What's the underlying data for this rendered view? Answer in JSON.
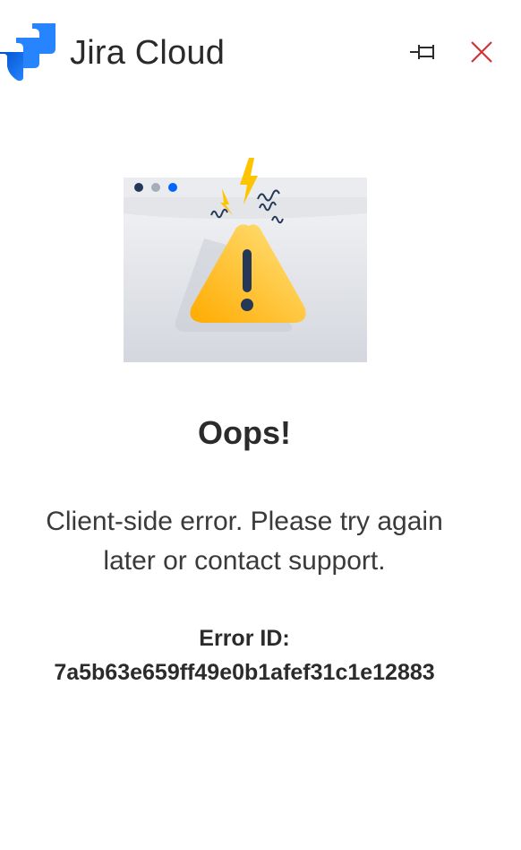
{
  "header": {
    "app_title": "Jira Cloud",
    "logo_icon": "jira-logo-icon",
    "pin_icon": "pin-icon",
    "close_icon": "close-icon"
  },
  "main": {
    "illustration_icon": "warning-browser-illustration",
    "heading": "Oops!",
    "message": "Client-side error. Please try again later or contact support.",
    "error_id_label": "Error ID:",
    "error_id_value": "7a5b63e659ff49e0b1afef31c1e12883"
  },
  "colors": {
    "brand_blue": "#2684ff",
    "close_red": "#d13438",
    "warning_yellow": "#ffc400",
    "text_dark": "#2b2b2b"
  }
}
